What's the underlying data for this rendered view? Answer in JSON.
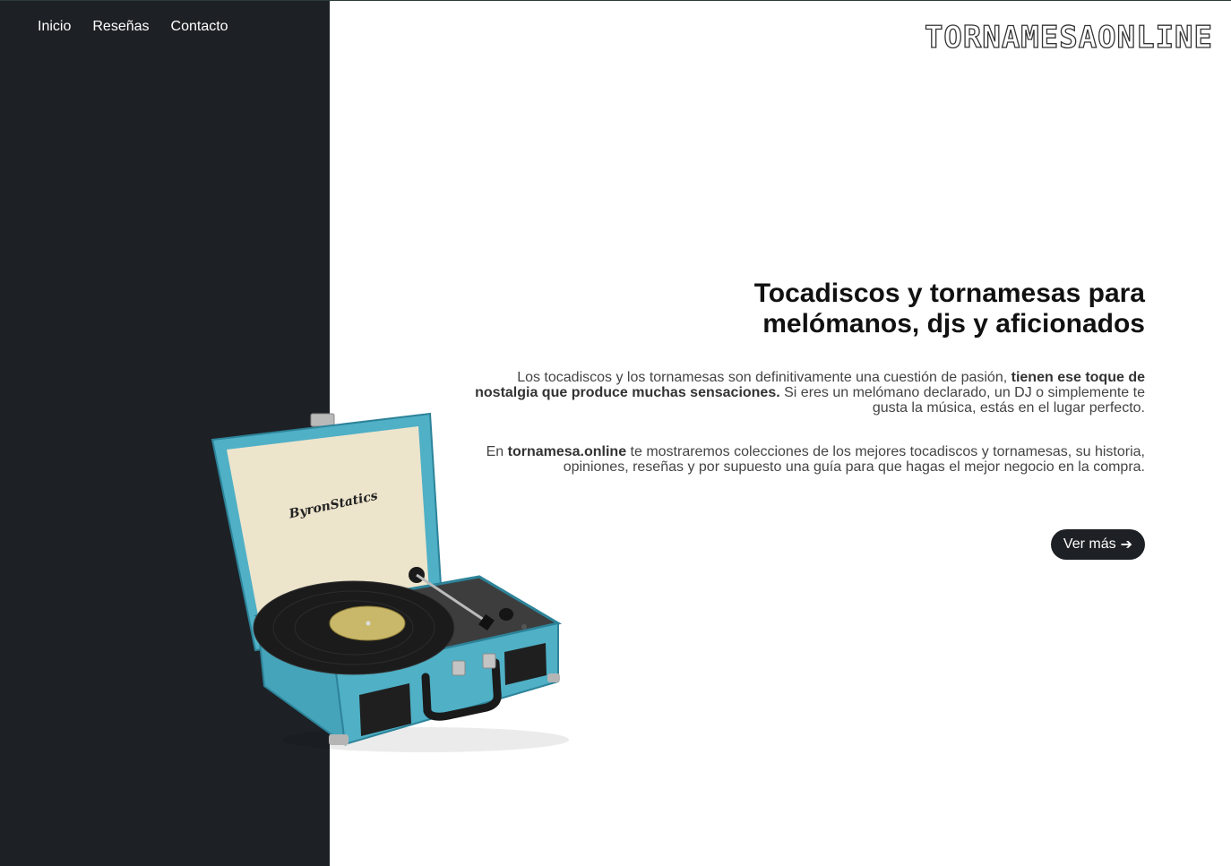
{
  "nav": {
    "items": [
      {
        "label": "Inicio"
      },
      {
        "label": "Reseñas"
      },
      {
        "label": "Contacto"
      }
    ]
  },
  "brand": {
    "logo_text": "TORNAMESAONLINE"
  },
  "hero": {
    "headline_line1": "Tocadiscos y tornamesas para",
    "headline_line2": "melómanos, djs y aficionados",
    "p1_a": "Los tocadiscos y los tornamesas son definitivamente una cuestión de pasión, ",
    "p1_bold": "tienen ese toque de nostalgia que produce muchas sensaciones.",
    "p1_b": " Si eres un melómano declarado, un DJ o simplemente te gusta la música, estás en el lugar perfecto.",
    "p2_a": "En ",
    "p2_bold": "tornamesa.online",
    "p2_b": " te mostraremos colecciones de los mejores tocadiscos y tornamesas, su historia, opiniones, reseñas y por supuesto una guía para que hagas el mejor negocio en la compra.",
    "cta_label": "Ver más",
    "cta_icon": "➔"
  },
  "product_image": {
    "brand_label": "ByronStatics"
  },
  "colors": {
    "dark_panel": "#1d2125",
    "case_teal": "#4fb0c6",
    "case_cream": "#ede4cc",
    "record_label": "#c9b86a"
  }
}
